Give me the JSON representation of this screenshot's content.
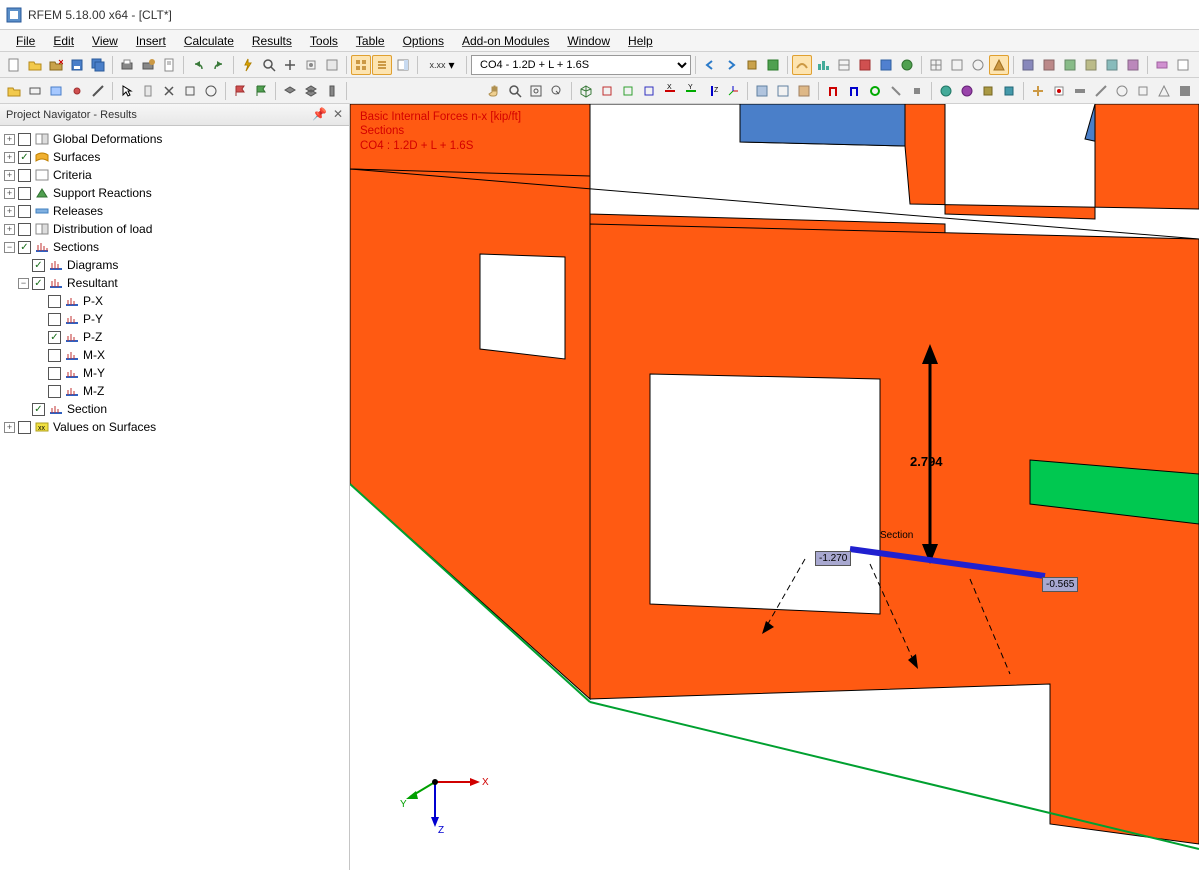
{
  "window": {
    "title": "RFEM 5.18.00 x64 - [CLT*]"
  },
  "menu": [
    "File",
    "Edit",
    "View",
    "Insert",
    "Calculate",
    "Results",
    "Tools",
    "Table",
    "Options",
    "Add-on Modules",
    "Window",
    "Help"
  ],
  "toolbar": {
    "combo_value": "CO4 - 1.2D + L + 1.6S",
    "xx_label": "x.xx"
  },
  "navigator": {
    "title": "Project Navigator - Results",
    "nodes": {
      "global_def": "Global Deformations",
      "surfaces": "Surfaces",
      "criteria": "Criteria",
      "support": "Support Reactions",
      "releases": "Releases",
      "distribution": "Distribution of load",
      "sections": "Sections",
      "diagrams": "Diagrams",
      "resultant": "Resultant",
      "px": "P-X",
      "py": "P-Y",
      "pz": "P-Z",
      "mx": "M-X",
      "my": "M-Y",
      "mz": "M-Z",
      "section": "Section",
      "values_on_surfaces": "Values on Surfaces"
    }
  },
  "viewport": {
    "overlay_line1": "Basic Internal Forces n-x [kip/ft]",
    "overlay_line2": "Sections",
    "overlay_line3": "CO4 : 1.2D + L + 1.6S",
    "force_value": "2.794",
    "section_label": "Section",
    "tag_left": "-1.270",
    "tag_right": "-0.565",
    "axis_x": "X",
    "axis_y": "Y",
    "axis_z": "Z"
  }
}
